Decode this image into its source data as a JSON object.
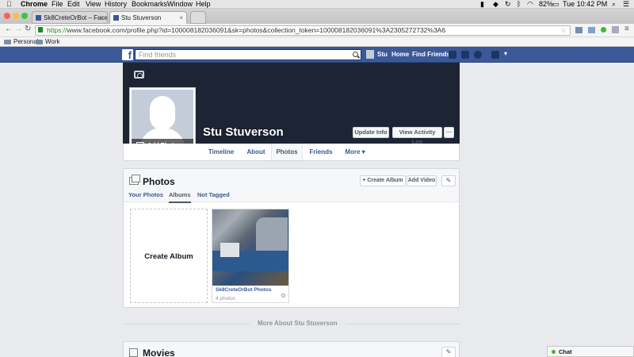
{
  "menubar": {
    "apple": "",
    "app": "Chrome",
    "items": [
      "File",
      "Edit",
      "View",
      "History",
      "Bookmarks",
      "Window",
      "Help"
    ],
    "battery": "82%",
    "clock": "Tue 10:42 PM"
  },
  "browser": {
    "tabs": [
      {
        "label": "Sk8CreteOrBot – Faceboo",
        "active": false
      },
      {
        "label": "Stu Stuverson",
        "active": true
      }
    ],
    "url_scheme": "https://",
    "url_rest": "www.facebook.com/profile.php?id=100008182036091&sk=photos&collection_token=100008182036091%3A2305272732%3A6",
    "bookmarks": [
      "Personal",
      "Work"
    ]
  },
  "fbnav": {
    "logo": "f",
    "search_placeholder": "Find friends",
    "user": "Stu",
    "home": "Home",
    "find_friends": "Find Friends"
  },
  "profile": {
    "name": "Stu Stuverson",
    "add_photo": "Add Photo",
    "update_info": "Update Info",
    "view_activity": "View Activity Log",
    "more_dots": "···",
    "tabs": [
      "Timeline",
      "About",
      "Photos",
      "Friends",
      "More ▾"
    ],
    "active_tab": "Photos"
  },
  "photos": {
    "title": "Photos",
    "subtabs": [
      "Your Photos",
      "Albums",
      "Not Tagged"
    ],
    "active_subtab": "Albums",
    "create_album_btn": "+ Create Album",
    "add_video_btn": "Add Video",
    "edit_btn": "✎",
    "create_album_tile": "Create Album",
    "album": {
      "title": "Sk8CreteOrBot Photos",
      "count": "4 photos"
    }
  },
  "more_about": "More About Stu Stuverson",
  "movies": {
    "title": "Movies",
    "edit_btn": "✎"
  },
  "chat": {
    "label": "Chat"
  },
  "colors": {
    "fb_blue": "#3b5998",
    "cover": "#1d2535",
    "page_bg": "#e9eaed"
  }
}
